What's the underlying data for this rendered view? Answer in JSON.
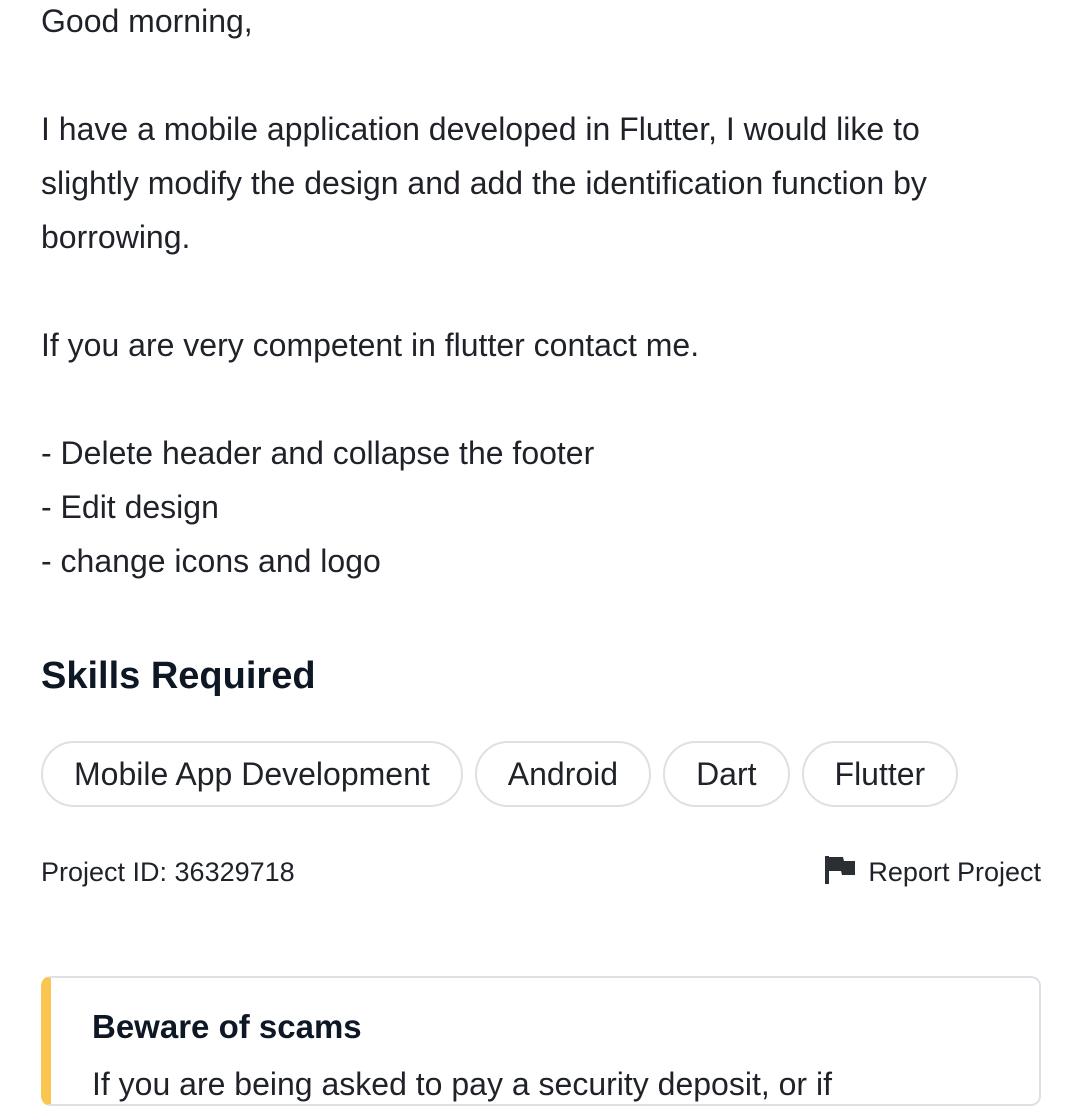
{
  "description": {
    "greeting": "Good morning,",
    "para1_line1": "I have a mobile application developed in Flutter, I would like to",
    "para1_line2": "slightly modify the design and add the identification function by",
    "para1_line3": "borrowing.",
    "para2": "If you are very competent in flutter contact me.",
    "bullets": [
      "- Delete header and collapse the footer",
      "- Edit design",
      "- change icons and logo"
    ]
  },
  "skills": {
    "title": "Skills Required",
    "items": [
      "Mobile App Development",
      "Android",
      "Dart",
      "Flutter"
    ]
  },
  "meta": {
    "project_id": "Project ID: 36329718",
    "report_label": "Report Project",
    "report_icon": "flag-icon"
  },
  "warning": {
    "title": "Beware of scams",
    "text": "If you are being asked to pay a security deposit, or if",
    "accent_color": "#f9c74f"
  }
}
